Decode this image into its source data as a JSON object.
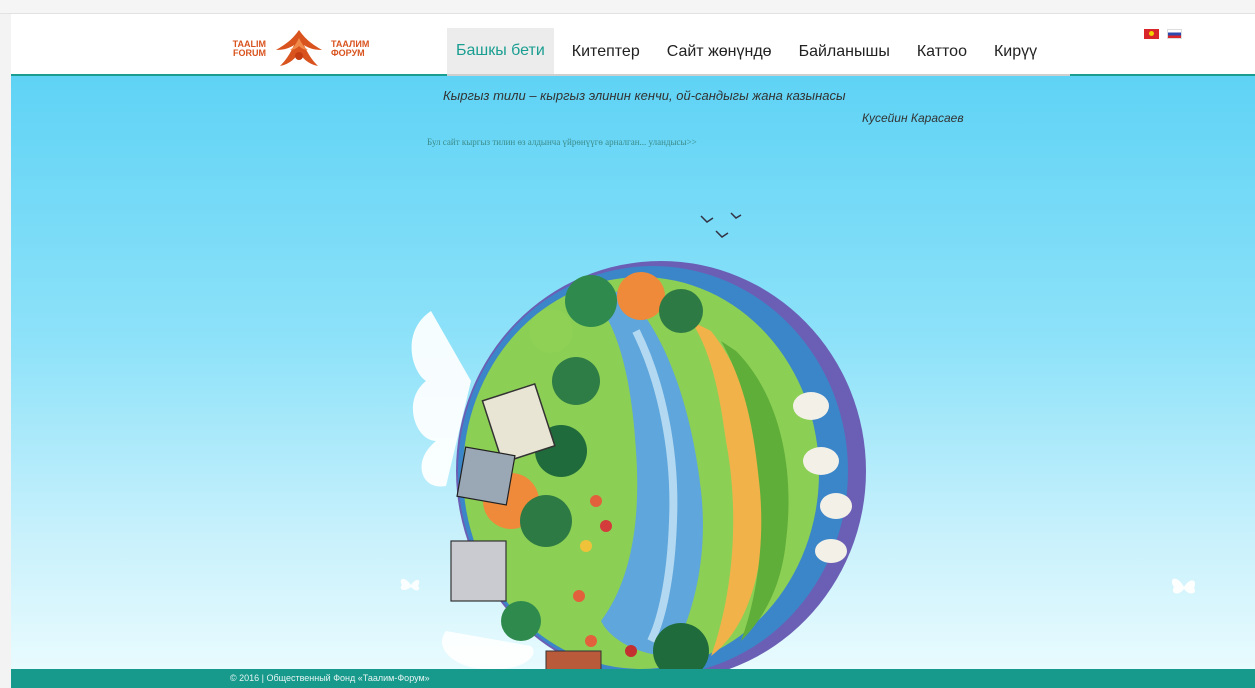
{
  "header": {
    "logo": {
      "left_text_line1": "TAALIM",
      "left_text_line2": "FORUM",
      "right_text_line1": "ТААЛИМ",
      "right_text_line2": "ФОРУМ",
      "brand_color": "#d9531e"
    },
    "nav": [
      {
        "label": "Башкы бети",
        "active": true
      },
      {
        "label": "Китептер",
        "active": false
      },
      {
        "label": "Сайт жөнүндө",
        "active": false
      },
      {
        "label": "Байланышы",
        "active": false
      },
      {
        "label": "Каттоо",
        "active": false
      },
      {
        "label": "Кирүү",
        "active": false
      }
    ],
    "languages": [
      "kg-flag-icon",
      "ru-flag-icon"
    ],
    "accent_color": "#1a9e91"
  },
  "hero": {
    "quote": "Кыргыз тили – кыргыз элинин кенчи, ой-сандыгы жана казынасы",
    "author": "Кусейин Карасаев",
    "intro_link": "Бул сайт кыргыз тилин өз алдынча үйрөнүүгө арналган... уландысы>>"
  },
  "footer": {
    "copyright": "© 2016 | Общественный Фонд «Таалим-Форум»",
    "color": "#17998c"
  }
}
